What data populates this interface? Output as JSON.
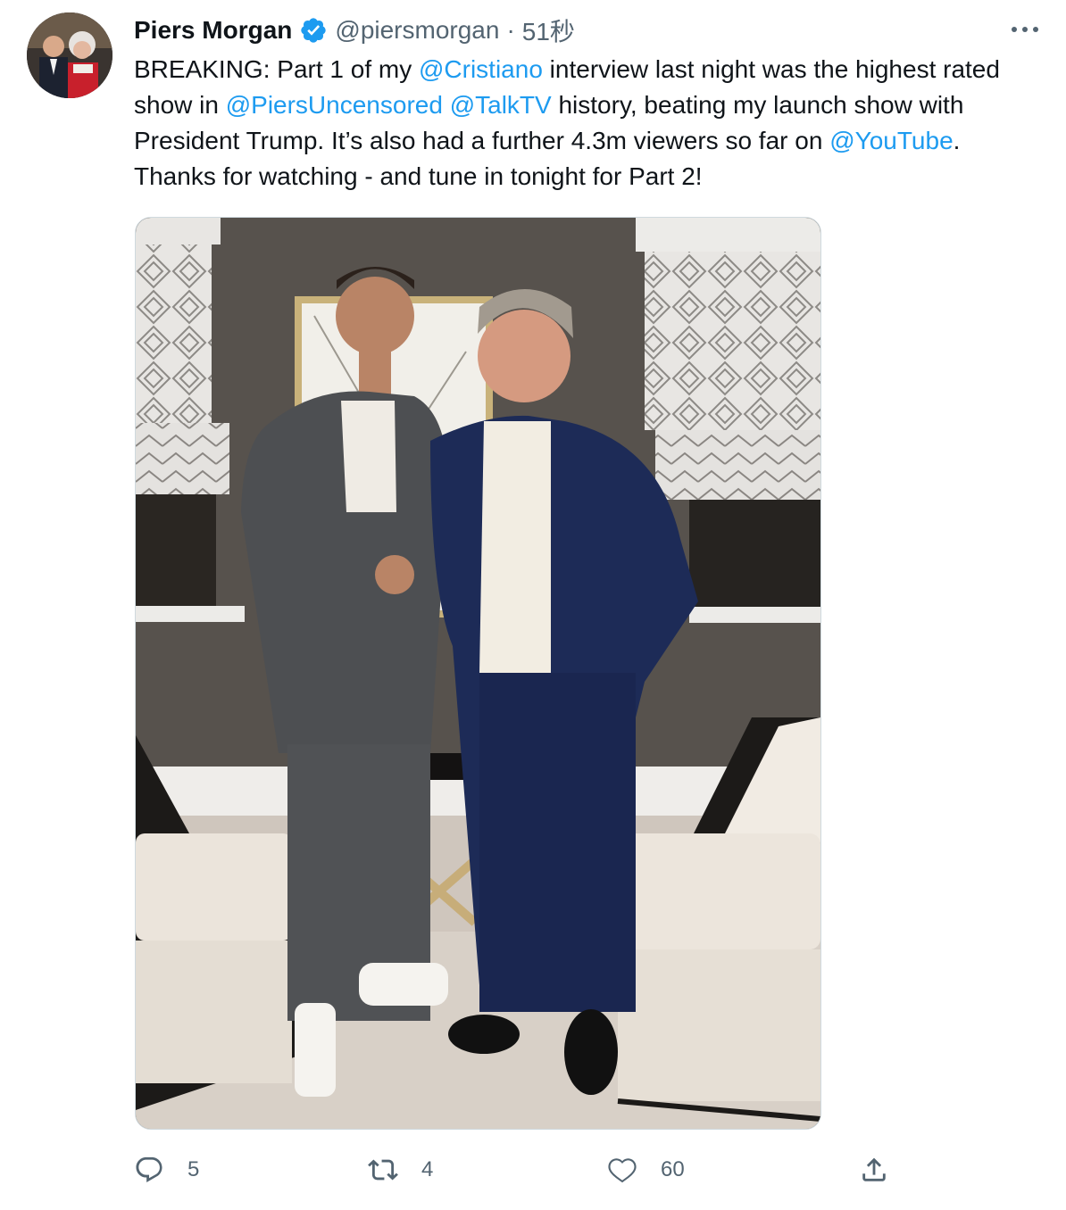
{
  "tweet": {
    "author_name": "Piers Morgan",
    "author_handle": "@piersmorgan",
    "separator": "·",
    "time": "51秒",
    "text_parts": {
      "t1": "BREAKING: Part 1 of my ",
      "m1": "@Cristiano",
      "t2": " interview last night was the highest rated show in ",
      "m2": "@PiersUncensored",
      "t3": " ",
      "m3": "@TalkTV",
      "t4": " history, beating my launch show with President Trump. It’s also had a further 4.3m viewers so far on ",
      "m4": "@YouTube",
      "t5": ". Thanks for watching - and tune in tonight for Part 2!"
    }
  },
  "actions": {
    "reply_count": "5",
    "retweet_count": "4",
    "like_count": "60"
  },
  "icons": {
    "verified": "verified-badge-icon",
    "more": "more-options-icon",
    "reply": "reply-icon",
    "retweet": "retweet-icon",
    "like": "heart-icon",
    "share": "share-icon"
  },
  "colors": {
    "accent": "#1d9bf0",
    "secondary_text": "#536471",
    "primary_text": "#0f1419"
  }
}
